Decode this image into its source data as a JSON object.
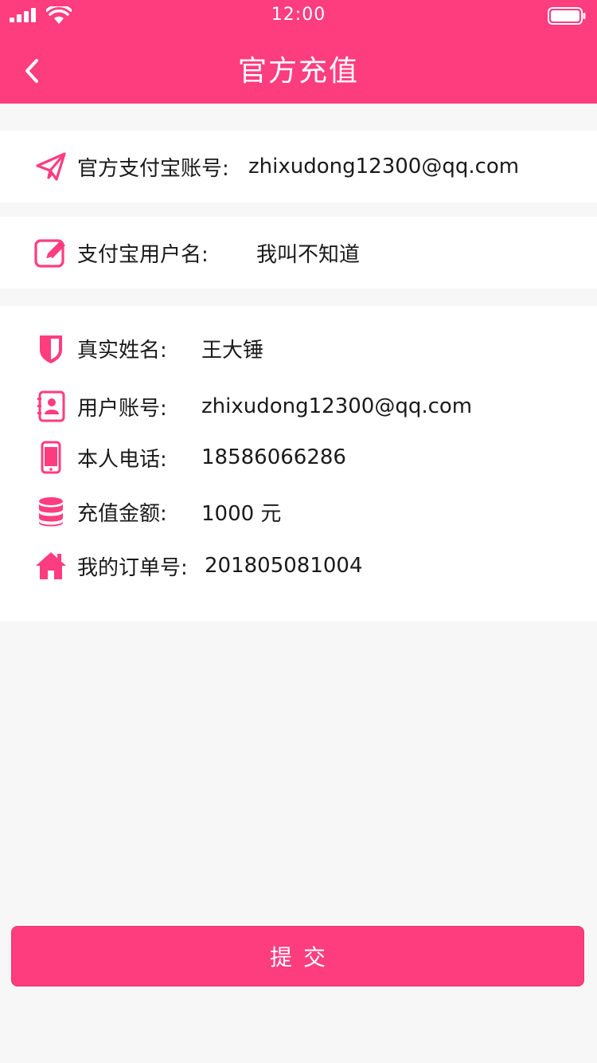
{
  "status_bar": {
    "time": "12:00"
  },
  "nav": {
    "title": "官方充值"
  },
  "alipay_account": {
    "label": "官方支付宝账号:",
    "value": "zhixudong12300@qq.com"
  },
  "alipay_username": {
    "label": "支付宝用户名:",
    "value": "我叫不知道"
  },
  "details": [
    {
      "label": "真实姓名:",
      "value": "王大锤",
      "icon": "shield-icon"
    },
    {
      "label": "用户账号:",
      "value": "zhixudong12300@qq.com",
      "icon": "contact-card-icon"
    },
    {
      "label": "本人电话:",
      "value": "18586066286",
      "icon": "phone-icon"
    },
    {
      "label": "充值金额:",
      "value": "1000 元",
      "icon": "coins-stack-icon"
    },
    {
      "label": "我的订单号:",
      "value": "201805081004",
      "icon": "home-icon"
    }
  ],
  "submit": {
    "label": "提交"
  },
  "colors": {
    "accent": "#fe3d7e",
    "background": "#f7f7f7",
    "card": "#ffffff"
  }
}
